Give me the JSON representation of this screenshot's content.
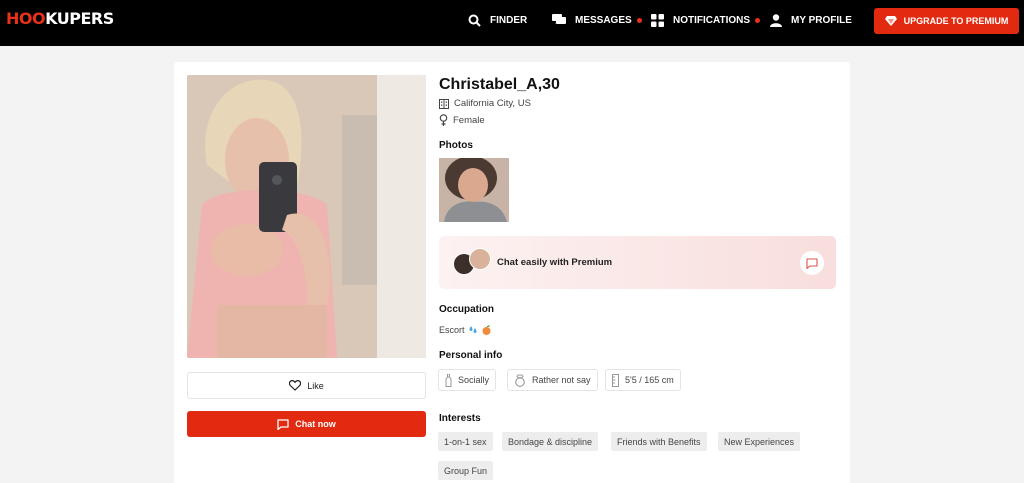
{
  "nav": {
    "logo_left": "HO",
    "logo_mid": "O",
    "logo_mid2": "KUP",
    "logo_right": "ERS",
    "finder": "FINDER",
    "messages": "MESSAGES",
    "notifications": "NOTIFICATIONS",
    "my_profile": "MY PROFILE",
    "upgrade": "UPGRADE TO PREMIUM",
    "accent_color": "#e22a10"
  },
  "profile": {
    "name": "Christabel_A,30",
    "location": "California City, US",
    "gender": "Female",
    "like_label": "Like",
    "chat_label": "Chat now"
  },
  "photos": {
    "title": "Photos"
  },
  "premium": {
    "text": "Chat easily with Premium"
  },
  "occupation": {
    "title": "Occupation",
    "value": "Escort"
  },
  "personal_info": {
    "title": "Personal info",
    "items": [
      "Socially",
      "Rather not say",
      "5'5 / 165 cm"
    ]
  },
  "interests": {
    "title": "Interests",
    "tags": [
      "1-on-1 sex",
      "Bondage & discipline",
      "Friends with Benefits",
      "New Experiences",
      "Group Fun"
    ]
  }
}
